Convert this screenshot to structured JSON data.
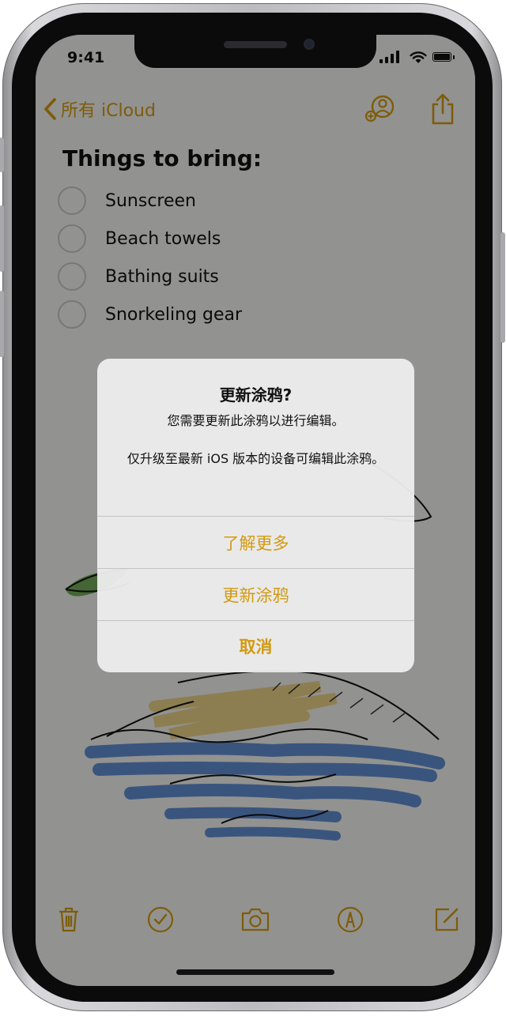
{
  "status_bar": {
    "time": "9:41"
  },
  "nav": {
    "back_label": "所有 iCloud"
  },
  "note": {
    "title": "Things to bring:",
    "checklist": [
      "Sunscreen",
      "Beach towels",
      "Bathing suits",
      "Snorkeling gear"
    ]
  },
  "alert": {
    "title": "更新涂鸦?",
    "message_line1": "您需要更新此涂鸦以进行编辑。",
    "message_line2": "仅升级至最新 iOS 版本的设备可编辑此涂鸦。",
    "buttons": {
      "learn_more": "了解更多",
      "update": "更新涂鸦",
      "cancel": "取消"
    }
  },
  "colors": {
    "accent": "#D39A0F",
    "dim_overlay": "rgba(0,0,0,0.4)"
  },
  "icons": {
    "nav": [
      "chevron-left-icon",
      "add-person-icon",
      "share-icon"
    ],
    "toolbar": [
      "trash-icon",
      "checklist-icon",
      "camera-icon",
      "markup-icon",
      "compose-icon"
    ]
  }
}
